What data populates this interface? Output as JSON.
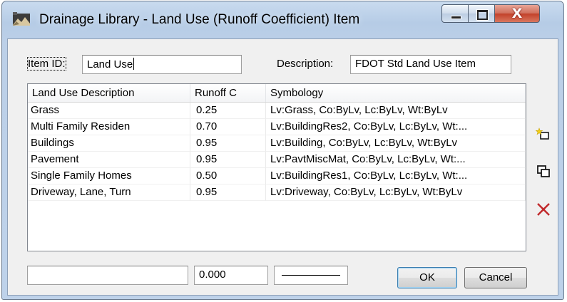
{
  "window": {
    "title": "Drainage Library - Land Use (Runoff Coefficient) Item",
    "controls": {
      "minimize_icon": "minimize-icon",
      "maximize_icon": "maximize-icon",
      "close_icon": "close-icon",
      "close_glyph": "X"
    }
  },
  "form": {
    "item_id_label": "Item ID:",
    "item_id_value": "Land Use",
    "description_label": "Description:",
    "description_value": "FDOT Std Land Use Item"
  },
  "table": {
    "columns": [
      "Land Use Description",
      "Runoff C",
      "Symbology"
    ],
    "rows": [
      {
        "description": "Grass",
        "runoff_c": "0.25",
        "symbology": "Lv:Grass, Co:ByLv, Lc:ByLv, Wt:ByLv"
      },
      {
        "description": "Multi Family Residen",
        "runoff_c": "0.70",
        "symbology": "Lv:BuildingRes2, Co:ByLv, Lc:ByLv, Wt:..."
      },
      {
        "description": "Buildings",
        "runoff_c": "0.95",
        "symbology": "Lv:Building, Co:ByLv, Lc:ByLv, Wt:ByLv"
      },
      {
        "description": "Pavement",
        "runoff_c": "0.95",
        "symbology": "Lv:PavtMiscMat, Co:ByLv, Lc:ByLv, Wt:..."
      },
      {
        "description": "Single Family Homes",
        "runoff_c": "0.50",
        "symbology": "Lv:BuildingRes1, Co:ByLv, Lc:ByLv, Wt:..."
      },
      {
        "description": "Driveway, Lane, Turn",
        "runoff_c": "0.95",
        "symbology": "Lv:Driveway, Co:ByLv, Lc:ByLv, Wt:ByLv"
      }
    ]
  },
  "side_tools": [
    {
      "icon": "new-item-icon"
    },
    {
      "icon": "copy-item-icon"
    },
    {
      "icon": "delete-item-icon"
    }
  ],
  "edit_row": {
    "description_value": "",
    "runoff_value": "0.000"
  },
  "buttons": {
    "ok": "OK",
    "cancel": "Cancel"
  },
  "colors": {
    "title_gradient": "#bcd0e8",
    "close_button": "#c2412a",
    "delete_icon": "#c0282a",
    "new_icon_star": "#f5d21a"
  }
}
